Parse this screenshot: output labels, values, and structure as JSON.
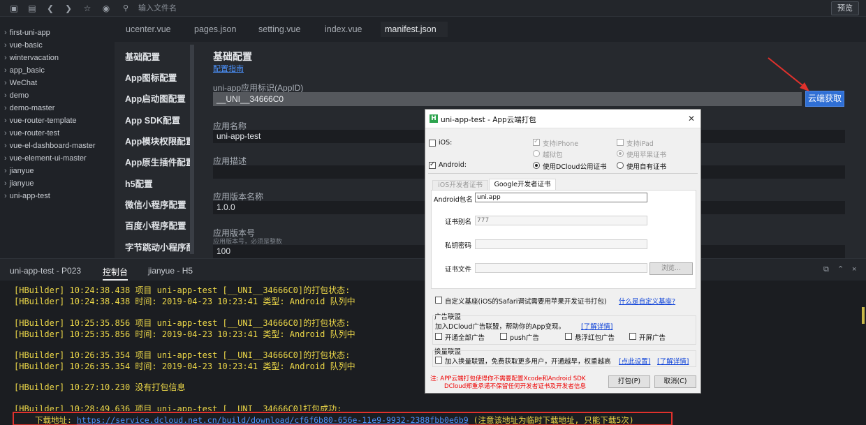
{
  "toolbar": {
    "search_placeholder": "输入文件名",
    "preview_label": "预览"
  },
  "sidebar": {
    "projects": [
      "first-uni-app",
      "vue-basic",
      "wintervacation",
      "app_basic",
      "WeChat",
      "demo",
      "demo-master",
      "vue-router-template",
      "vue-router-test",
      "vue-el-dashboard-master",
      "vue-element-ui-master",
      "jianyue",
      "jianyue",
      "uni-app-test"
    ]
  },
  "tabs": [
    "ucenter.vue",
    "pages.json",
    "setting.vue",
    "index.vue",
    "manifest.json"
  ],
  "settings_nav": [
    "基础配置",
    "App图标配置",
    "App启动图配置",
    "App SDK配置",
    "App模块权限配置",
    "App原生插件配置",
    "h5配置",
    "微信小程序配置",
    "百度小程序配置",
    "字节跳动小程序配置"
  ],
  "main": {
    "title": "基础配置",
    "guide_link": "配置指南",
    "appid_label": "uni-app应用标识(AppID)",
    "appid_value": "__UNI__34666C0",
    "cloud_btn": "云端获取",
    "name_label": "应用名称",
    "name_value": "uni-app-test",
    "desc_label": "应用描述",
    "desc_value": "",
    "version_name_label": "应用版本名称",
    "version_name_value": "1.0.0",
    "version_code_label": "应用版本号",
    "version_code_hint": "应用版本号，必须是整数",
    "version_code_value": "100"
  },
  "console_tabs": [
    "uni-app-test - P023",
    "控制台",
    "jianyue - H5"
  ],
  "console_lines": [
    "[HBuilder] 10:24:38.438 项目 uni-app-test [__UNI__34666C0]的打包状态:",
    "[HBuilder] 10:24:38.438 时间: 2019-04-23 10:23:41    类型: Android    队列中",
    "[HBuilder] 10:25:35.856 项目 uni-app-test [__UNI__34666C0]的打包状态:",
    "[HBuilder] 10:25:35.856 时间: 2019-04-23 10:23:41    类型: Android    队列中",
    "[HBuilder] 10:26:35.354 项目 uni-app-test [__UNI__34666C0]的打包状态:",
    "[HBuilder] 10:26:35.354 时间: 2019-04-23 10:23:41    类型: Android    队列中",
    "[HBuilder] 10:27:10.230 没有打包信息",
    "[HBuilder] 10:28:49.636 项目 uni-app-test [__UNI__34666C0]打包成功:"
  ],
  "download": {
    "label": "下载地址: ",
    "url": "https://service.dcloud.net.cn/build/download/cf6f6b80-656e-11e9-9932-2388fbb0e6b9",
    "note": " (注意该地址为临时下载地址, 只能下载5次)"
  },
  "dialog": {
    "title": "uni-app-test - App云端打包",
    "close": "✕",
    "ios_label": "iOS:",
    "support_iphone": "支持iPhone",
    "support_ipad": "支持iPad",
    "jailbreak": "越狱包",
    "apple_cert": "使用苹果证书",
    "android_label": "Android:",
    "dcloud_cert": "使用DCloud公用证书",
    "own_cert": "使用自有证书",
    "tab_ios": "iOS开发者证书",
    "tab_google": "Google开发者证书",
    "pkg_label": "Android包名",
    "pkg_value": "uni.app",
    "alias_label": "证书别名",
    "alias_value": "777",
    "key_label": "私钥密码",
    "file_label": "证书文件",
    "browse": "浏览...",
    "custom_base": "自定义基座(iOS的Safari调试需要用苹果开发证书打包)",
    "what_custom": "什么是自定义基座?",
    "ad_title": "广告联盟",
    "ad_desc": "加入DCloud广告联盟，帮助你的App变现。",
    "learn_more": "[了解详情]",
    "ad_all": "开通全部广告",
    "ad_push": "push广告",
    "ad_float": "悬浮红包广告",
    "ad_splash": "开屏广告",
    "swap_title": "换量联盟",
    "swap_desc": "加入换量联盟，免费获取更多用户，开通越早，权重越高",
    "click_set": "[点此设置]",
    "note_line1": "注: APP云端打包使得你不需要配置Xcode和Android SDK",
    "note_line2": "DCloud郑重承诺不保留任何开发者证书及开发者信息",
    "pack_btn": "打包(P)",
    "cancel_btn": "取消(C)"
  }
}
